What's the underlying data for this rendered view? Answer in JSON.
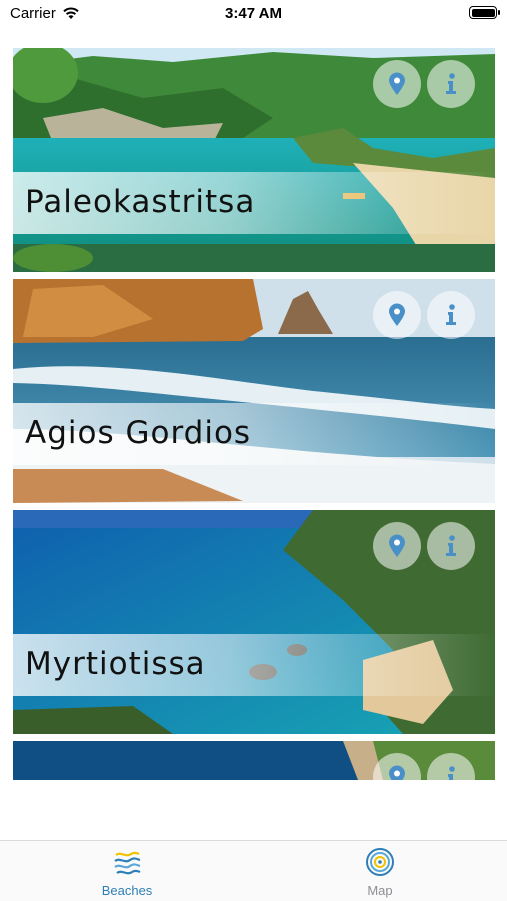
{
  "status_bar": {
    "carrier": "Carrier",
    "time": "3:47 AM"
  },
  "beaches": [
    {
      "name": "Paleokastritsa"
    },
    {
      "name": "Agios Gordios"
    },
    {
      "name": "Myrtiotissa"
    },
    {
      "name": ""
    }
  ],
  "tabs": [
    {
      "label": "Beaches",
      "icon": "waves-icon",
      "selected": true,
      "color": "#2e7fb8"
    },
    {
      "label": "Map",
      "icon": "map-target-icon",
      "selected": false,
      "color": "#8e8e93"
    }
  ],
  "icons": {
    "location": "location-pin-icon",
    "info": "info-icon"
  }
}
